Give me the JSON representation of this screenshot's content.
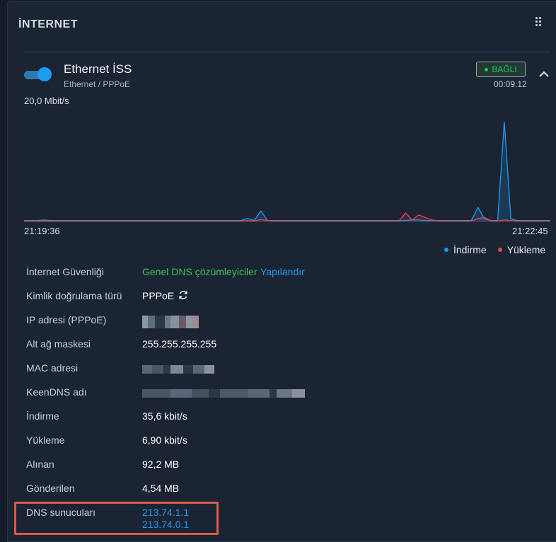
{
  "panel": {
    "title": "İNTERNET"
  },
  "connection": {
    "name": "Ethernet İSS",
    "subtitle": "Ethernet / PPPoE",
    "enabled": true,
    "status": "BAĞLI",
    "uptime": "00:09:12"
  },
  "chart_data": {
    "type": "line",
    "y_max_label": "20,0 Mbit/s",
    "x_start": "21:19:36",
    "x_end": "21:22:45",
    "series": [
      {
        "name": "İndirme",
        "color": "#1d9bf0",
        "values": [
          0.2,
          0.2,
          0.2,
          0.3,
          0.2,
          0.2,
          0.2,
          0.2,
          0.2,
          0.2,
          0.2,
          0.2,
          0.2,
          0.2,
          0.2,
          0.2,
          0.2,
          0.2,
          0.2,
          0.2,
          0.2,
          0.2,
          0.2,
          0.2,
          0.2,
          0.2,
          0.2,
          0.2,
          0.2,
          0.2,
          0.2,
          0.2,
          0.2,
          0.2,
          0.6,
          0.2,
          2.1,
          0.2,
          0.2,
          0.2,
          0.2,
          0.2,
          0.2,
          0.2,
          0.2,
          0.2,
          0.2,
          0.2,
          0.2,
          0.2,
          0.2,
          0.2,
          0.2,
          0.2,
          0.2,
          0.2,
          0.2,
          0.2,
          0.2,
          0.3,
          0.3,
          0.2,
          0.2,
          0.2,
          0.2,
          0.2,
          0.2,
          0.2,
          0.2,
          2.8,
          0.5,
          0.2,
          0.2,
          20.0,
          0.5,
          0.2,
          0.2,
          0.2,
          0.2,
          0.2,
          0.2
        ]
      },
      {
        "name": "Yükleme",
        "color": "#e0474f",
        "values": [
          0.1,
          0.1,
          0.1,
          0.1,
          0.1,
          0.1,
          0.1,
          0.1,
          0.1,
          0.1,
          0.1,
          0.1,
          0.1,
          0.1,
          0.1,
          0.1,
          0.1,
          0.1,
          0.1,
          0.1,
          0.1,
          0.1,
          0.1,
          0.1,
          0.1,
          0.1,
          0.1,
          0.1,
          0.1,
          0.1,
          0.1,
          0.1,
          0.1,
          0.1,
          0.2,
          0.1,
          0.4,
          0.2,
          0.1,
          0.1,
          0.1,
          0.1,
          0.1,
          0.1,
          0.1,
          0.1,
          0.1,
          0.1,
          0.1,
          0.1,
          0.1,
          0.1,
          0.1,
          0.1,
          0.1,
          0.1,
          0.1,
          0.1,
          1.7,
          0.3,
          1.3,
          0.8,
          0.3,
          0.1,
          0.1,
          0.1,
          0.1,
          0.1,
          0.1,
          0.6,
          0.8,
          0.1,
          0.1,
          0.3,
          0.2,
          0.1,
          0.1,
          0.1,
          0.1,
          0.1,
          0.1
        ]
      }
    ],
    "ylim": [
      0,
      20
    ]
  },
  "legend": {
    "download": "İndirme",
    "upload": "Yükleme"
  },
  "info": {
    "security_label": "İnternet Güvenliği",
    "security_value": "Genel DNS çözümleyiciler",
    "security_link": "Yapılandır",
    "auth_label": "Kimlik doğrulama türü",
    "auth_value": "PPPoE",
    "ip_label": "IP adresi (PPPoE)",
    "mask_label": "Alt ağ maskesi",
    "mask_value": "255.255.255.255",
    "mac_label": "MAC adresi",
    "keendns_label": "KeenDNS adı",
    "download_label": "İndirme",
    "download_value": "35,6 kbit/s",
    "upload_label": "Yükleme",
    "upload_value": "6,90 kbit/s",
    "received_label": "Alınan",
    "received_value": "92,2 MB",
    "sent_label": "Gönderilen",
    "sent_value": "4,54 MB",
    "dns_label": "DNS sunucuları",
    "dns_servers": [
      "213.74.1.1",
      "213.74.0.1"
    ]
  },
  "icons": {
    "drag": "grip-icon",
    "collapse": "chevron-up-icon",
    "refresh": "refresh-icon"
  },
  "colors": {
    "accent": "#1d9bf0",
    "connected": "#22c55e",
    "upload": "#e0474f",
    "highlight": "#d95b45"
  }
}
